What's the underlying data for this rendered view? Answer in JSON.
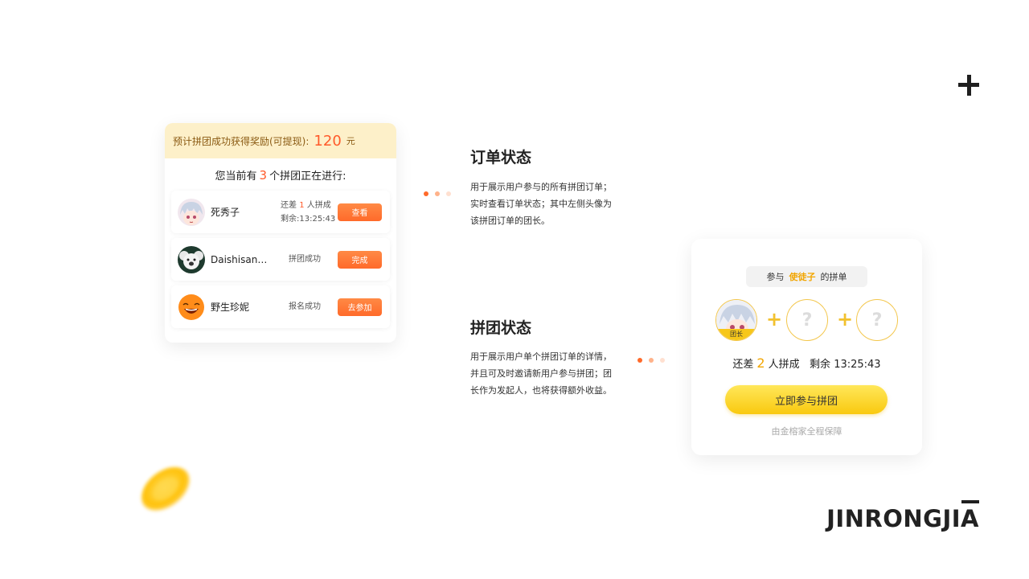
{
  "brand": {
    "name": "JINRONGJIA"
  },
  "left_card": {
    "reward_label": "预计拼团成功获得奖励(可提现):",
    "reward_amount": "120",
    "reward_unit": "元",
    "ongoing_prefix": "您当前有",
    "ongoing_count": "3",
    "ongoing_suffix": "个拼团正在进行:",
    "rows": [
      {
        "name": "死秀子",
        "status_prefix": "还差",
        "status_count": "1",
        "status_suffix": "人拼成",
        "status_time": "剩余:13:25:43",
        "button": "查看"
      },
      {
        "name": "Daishisan…",
        "status": "拼团成功",
        "button": "完成"
      },
      {
        "name": "野生珍妮",
        "status": "报名成功",
        "button": "去参加"
      }
    ]
  },
  "sections": {
    "order": {
      "title": "订单状态",
      "desc": "用于展示用户参与的所有拼团订单；实时查看订单状态；其中左侧头像为该拼团订单的团长。"
    },
    "group": {
      "title": "拼团状态",
      "desc": "用于展示用户单个拼团订单的详情，并且可及时邀请新用户参与拼团；团长作为发起人，也将获得额外收益。"
    }
  },
  "right_card": {
    "join_prefix": "参与",
    "join_name": "使徒子",
    "join_suffix": "的拼单",
    "leader_tag": "团长",
    "empty_slot_symbol": "?",
    "plus_symbol": "+",
    "remain_prefix": "还差",
    "remain_count": "2",
    "remain_suffix": "人拼成",
    "remain_time_label": "剩余",
    "remain_time": "13:25:43",
    "join_button": "立即参与拼团",
    "guarantee": "由金榕家全程保障"
  },
  "colors": {
    "accent_orange": "#ff6a2a",
    "accent_yellow": "#f9c90f",
    "reward_bg": "#fdf0c9"
  }
}
